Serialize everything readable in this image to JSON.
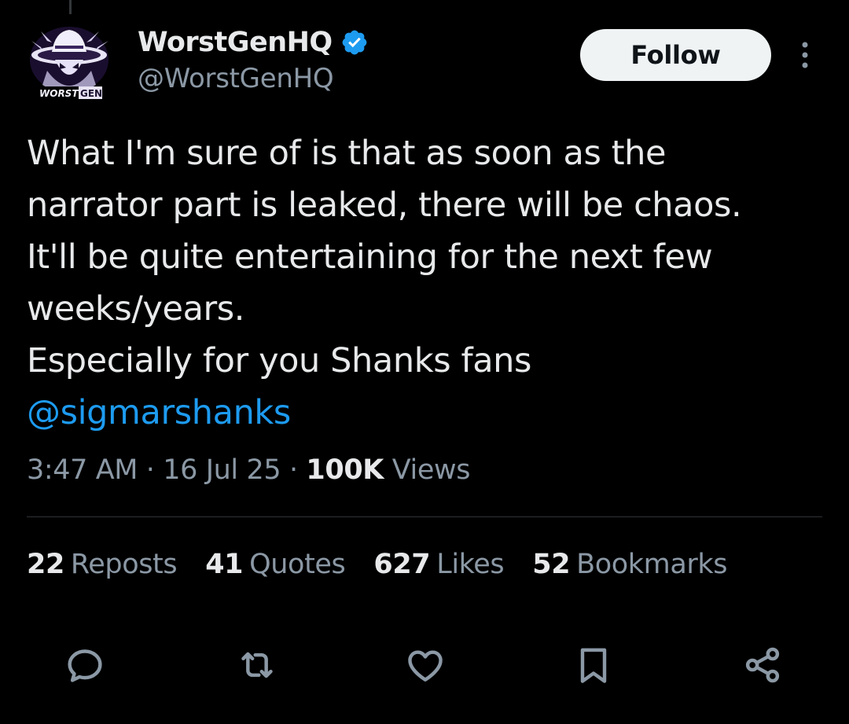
{
  "author": {
    "display_name": "WorstGenHQ",
    "handle": "@WorstGenHQ",
    "avatar_text": "WORST GEN",
    "verified_icon": "verified-badge-icon"
  },
  "header": {
    "follow_label": "Follow",
    "more_icon": "more-vertical-icon"
  },
  "tweet": {
    "lines": [
      "What I'm sure of is that as soon as the",
      "narrator part is leaked, there will be chaos.",
      "It'll be quite entertaining for the next few",
      "weeks/years.",
      "Especially for you Shanks fans"
    ],
    "mention": "@sigmarshanks"
  },
  "meta": {
    "time": "3:47 AM",
    "separator": "·",
    "date": "16 Jul 25",
    "views_count": "100K",
    "views_label": "Views"
  },
  "stats": [
    {
      "count": "22",
      "label": "Reposts"
    },
    {
      "count": "41",
      "label": "Quotes"
    },
    {
      "count": "627",
      "label": "Likes"
    },
    {
      "count": "52",
      "label": "Bookmarks"
    }
  ],
  "actions": [
    "reply-icon",
    "repost-icon",
    "like-icon",
    "bookmark-icon",
    "share-icon"
  ],
  "colors": {
    "background": "#000000",
    "text_primary": "#e7e9ea",
    "text_secondary": "#8b98a5",
    "accent": "#1d9bf0",
    "follow_bg": "#eff3f4"
  }
}
